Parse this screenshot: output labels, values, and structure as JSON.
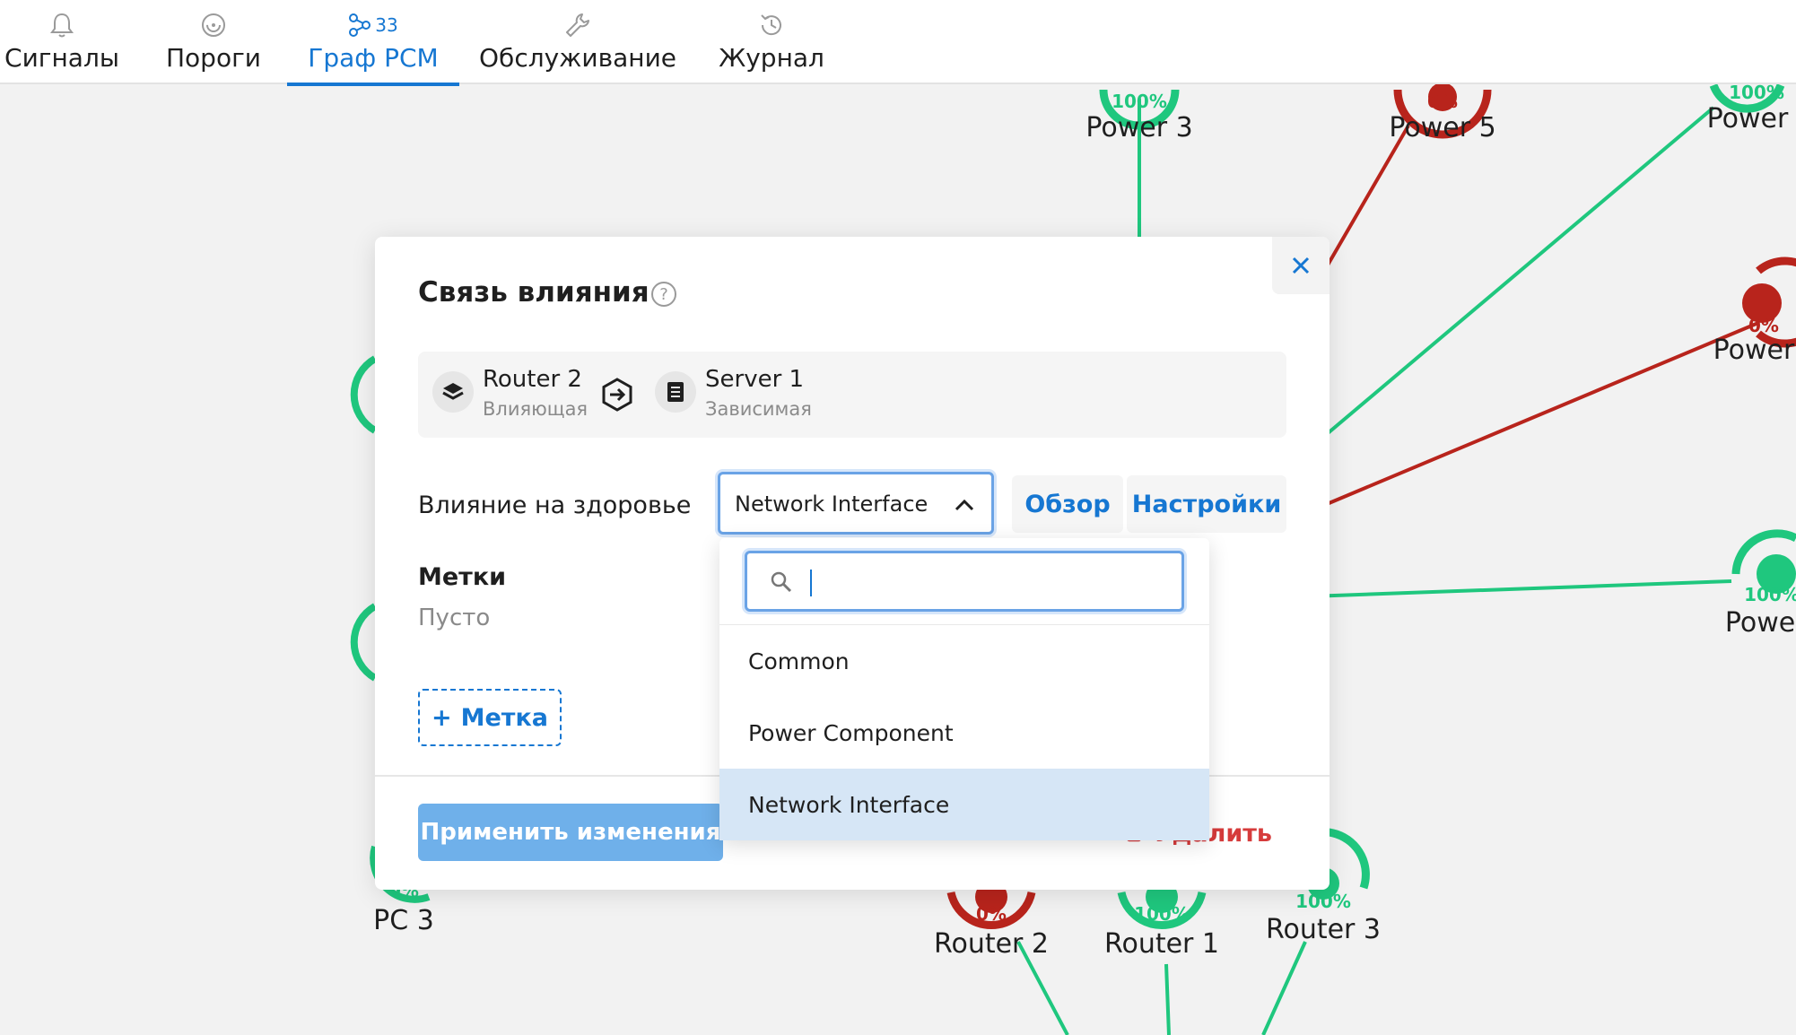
{
  "tabs": [
    {
      "label": "Сигналы",
      "icon": "bell-icon"
    },
    {
      "label": "Пороги",
      "icon": "threshold-icon"
    },
    {
      "label": "Граф РСМ",
      "icon": "graph-icon",
      "badge": "33",
      "active": true
    },
    {
      "label": "Обслуживание",
      "icon": "wrench-icon"
    },
    {
      "label": "Журнал",
      "icon": "history-icon"
    }
  ],
  "graph": {
    "nodes": [
      {
        "label": "Power 3",
        "pct": "100%",
        "status": "ok"
      },
      {
        "label": "Power 5",
        "pct": "0%",
        "status": "error"
      },
      {
        "label": "Power",
        "pct": "100%",
        "status": "ok"
      },
      {
        "label": "Power",
        "pct": "0%",
        "status": "error"
      },
      {
        "label": "Powe",
        "pct": "100%",
        "status": "ok"
      },
      {
        "label": "PC 3",
        "pct": "0%",
        "status": "ok"
      },
      {
        "label": "Router 2",
        "pct": "0%",
        "status": "error"
      },
      {
        "label": "Router 1",
        "pct": "100%",
        "status": "ok"
      },
      {
        "label": "Router 3",
        "pct": "100%",
        "status": "ok"
      }
    ],
    "colors": {
      "ok": "#1fc77e",
      "error": "#b8241c"
    }
  },
  "modal": {
    "title": "Связь влияния",
    "source": {
      "name": "Router 2",
      "role": "Влияющая",
      "icon": "layers-icon"
    },
    "target": {
      "name": "Server 1",
      "role": "Зависимая",
      "icon": "server-icon"
    },
    "health_label": "Влияние на здоровье",
    "health_value": "Network Interface",
    "overview_button": "Обзор",
    "settings_button": "Настройки",
    "tags_title": "Метки",
    "tags_empty": "Пусто",
    "add_tag_button": "Метка",
    "apply_button": "Применить изменения",
    "delete_button": "Удалить"
  },
  "dropdown": {
    "search_placeholder": "",
    "options": [
      "Common",
      "Power Component",
      "Network Interface"
    ],
    "selected": "Network Interface"
  },
  "accent_color": "#1677d2"
}
